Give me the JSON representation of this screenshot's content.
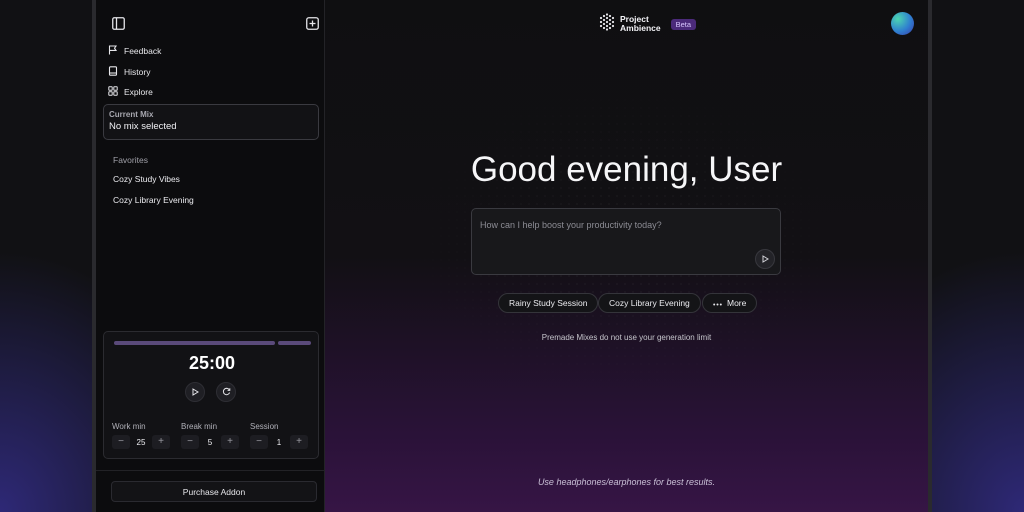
{
  "sidebar": {
    "nav": [
      {
        "label": "Feedback",
        "icon": "flag-icon"
      },
      {
        "label": "History",
        "icon": "book-icon"
      },
      {
        "label": "Explore",
        "icon": "grid-icon"
      }
    ],
    "current_mix": {
      "label": "Current Mix",
      "value": "No mix selected"
    },
    "favorites": {
      "heading": "Favorites",
      "items": [
        "Cozy Study Vibes",
        "Cozy Library Evening"
      ]
    },
    "timer": {
      "time": "25:00",
      "progress": 0.75,
      "work": {
        "label": "Work min",
        "value": "25"
      },
      "break": {
        "label": "Break min",
        "value": "5"
      },
      "session": {
        "label": "Session",
        "value": "1"
      }
    },
    "purchase_label": "Purchase Addon"
  },
  "header": {
    "logo_line1": "Project",
    "logo_line2": "Ambience",
    "badge": "Beta"
  },
  "main": {
    "greeting": "Good evening, User",
    "prompt_placeholder": "How can I help boost your productivity today?",
    "chips": [
      "Rainy Study Session",
      "Cozy Library Evening",
      "More"
    ],
    "note": "Premade Mixes do not use your generation limit",
    "footer": "Use headphones/earphones for best results."
  },
  "colors": {
    "accent": "#4b2a7a",
    "badge_text": "#d8c6ff",
    "bottom_glow": "#361545"
  }
}
